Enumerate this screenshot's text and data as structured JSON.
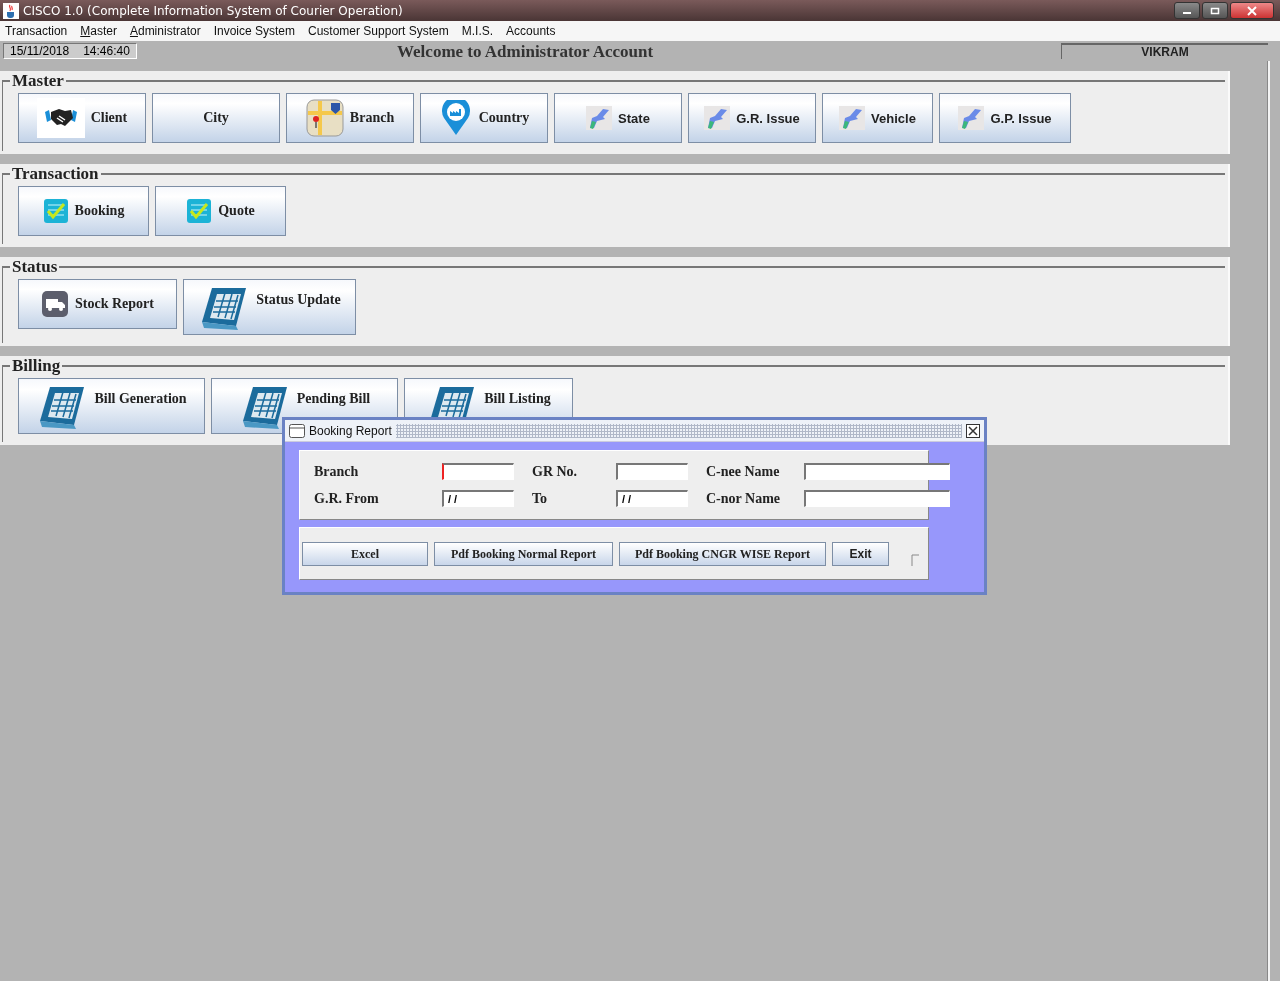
{
  "window": {
    "title": "CISCO 1.0 (Complete Information System of Courier Operation)"
  },
  "menu": [
    {
      "label": "Transaction",
      "mnemonic_underlined": false
    },
    {
      "label": "Master",
      "mnemonic_underlined": true
    },
    {
      "label": "Administrator",
      "mnemonic_underlined": true
    },
    {
      "label": "Invoice System",
      "mnemonic_underlined": false
    },
    {
      "label": "Customer Support System",
      "mnemonic_underlined": false
    },
    {
      "label": "M.I.S.",
      "mnemonic_underlined": false
    },
    {
      "label": "Accounts",
      "mnemonic_underlined": false
    }
  ],
  "status_row": {
    "date": "15/11/2018",
    "time": "14:46:40",
    "welcome": "Welcome to Administrator Account",
    "user": "VIKRAM"
  },
  "sections": [
    {
      "title": "Master",
      "buttons": [
        {
          "label": "Client",
          "kind": "handshake"
        },
        {
          "label": "City",
          "kind": "none"
        },
        {
          "label": "Branch",
          "kind": "map"
        },
        {
          "label": "Country",
          "kind": "pin"
        },
        {
          "label": "State",
          "kind": "bird"
        },
        {
          "label": "G.R. Issue",
          "kind": "bird"
        },
        {
          "label": "Vehicle",
          "kind": "bird"
        },
        {
          "label": "G.P. Issue",
          "kind": "bird"
        }
      ]
    },
    {
      "title": "Transaction",
      "buttons": [
        {
          "label": "Booking",
          "kind": "checklist"
        },
        {
          "label": "Quote",
          "kind": "checklist"
        }
      ]
    },
    {
      "title": "Status",
      "buttons": [
        {
          "label": "Stock Report",
          "kind": "truck"
        },
        {
          "label": "Status Update",
          "kind": "calendar"
        }
      ]
    },
    {
      "title": "Billing",
      "buttons": [
        {
          "label": "Bill Generation",
          "kind": "calendar"
        },
        {
          "label": "Pending Bill",
          "kind": "calendar"
        },
        {
          "label": "Bill Listing",
          "kind": "calendar"
        }
      ]
    }
  ],
  "dialog": {
    "title": "Booking Report",
    "fields": [
      {
        "label": "Branch",
        "focused": true
      },
      {
        "label": "GR No.",
        "focused": false
      },
      {
        "label": "C-nee Name",
        "focused": false
      },
      {
        "label": "G.R. From",
        "value": "/ /",
        "focused": false
      },
      {
        "label": "To",
        "value": "/ /",
        "focused": false
      },
      {
        "label": "C-nor Name",
        "focused": false
      }
    ],
    "buttons": [
      "Excel",
      "Pdf Booking Normal Report",
      "Pdf Booking CNGR WISE Report",
      "Exit"
    ]
  }
}
